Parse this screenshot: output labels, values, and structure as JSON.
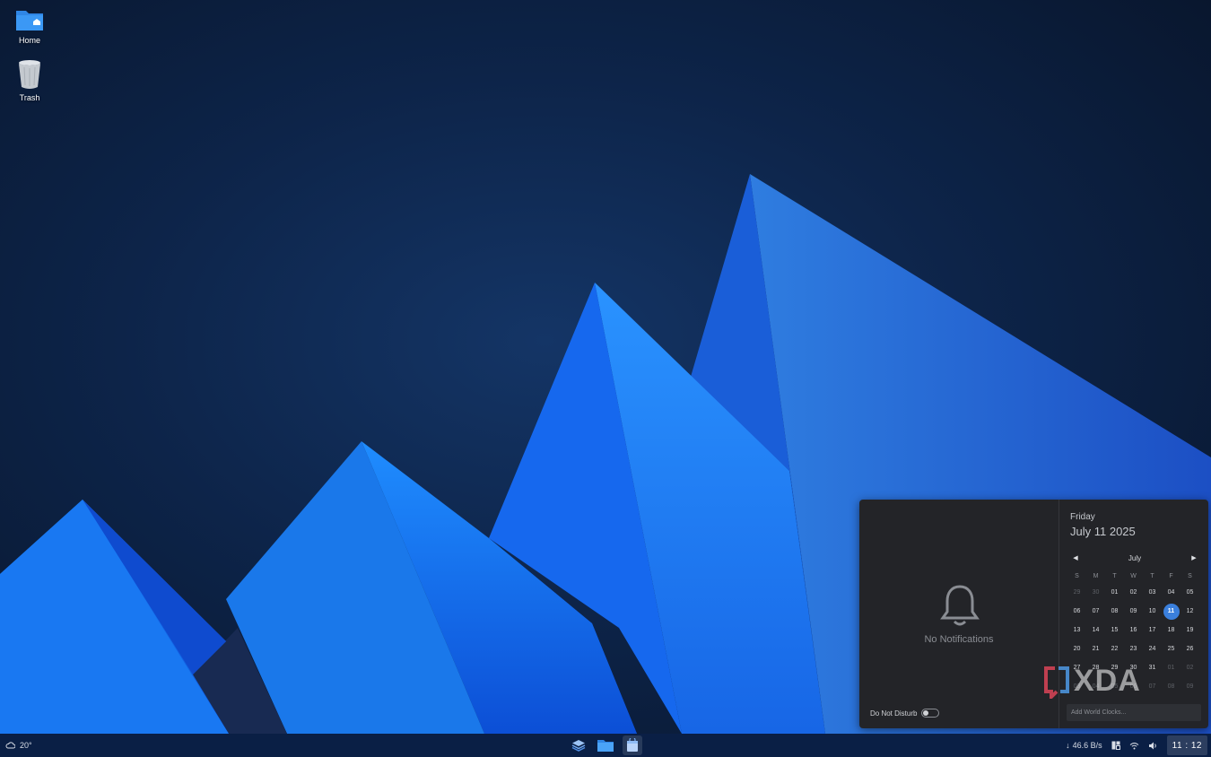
{
  "desktop": {
    "icons": [
      {
        "label": "Home",
        "icon": "folder-home-icon"
      },
      {
        "label": "Trash",
        "icon": "trash-icon"
      }
    ]
  },
  "taskbar": {
    "weather": {
      "icon": "cloud-icon",
      "temperature": "20°"
    },
    "apps": [
      {
        "icon": "layers-icon"
      },
      {
        "icon": "file-manager-icon"
      },
      {
        "icon": "store-icon"
      }
    ],
    "tray": {
      "network_speed": "46.6 B/s",
      "clock": "11 : 12"
    }
  },
  "notification_panel": {
    "empty_text": "No Notifications",
    "do_not_disturb_label": "Do Not Disturb",
    "do_not_disturb_enabled": false
  },
  "calendar": {
    "weekday": "Friday",
    "full_date": "July 11 2025",
    "month": "July",
    "day_headers": [
      "S",
      "M",
      "T",
      "W",
      "T",
      "F",
      "S"
    ],
    "rows": [
      [
        "29",
        "30",
        "01",
        "02",
        "03",
        "04",
        "05"
      ],
      [
        "06",
        "07",
        "08",
        "09",
        "10",
        "11",
        "12"
      ],
      [
        "13",
        "14",
        "15",
        "16",
        "17",
        "18",
        "19"
      ],
      [
        "20",
        "21",
        "22",
        "23",
        "24",
        "25",
        "26"
      ],
      [
        "27",
        "28",
        "29",
        "30",
        "31",
        "01",
        "02"
      ],
      [
        "03",
        "04",
        "05",
        "06",
        "07",
        "08",
        "09"
      ]
    ],
    "today": "11",
    "world_clocks_placeholder": "Add World Clocks..."
  },
  "watermark": "XDA",
  "colors": {
    "accent": "#3a7fdc",
    "taskbar": "#0a1f45",
    "panel": "#232428"
  }
}
